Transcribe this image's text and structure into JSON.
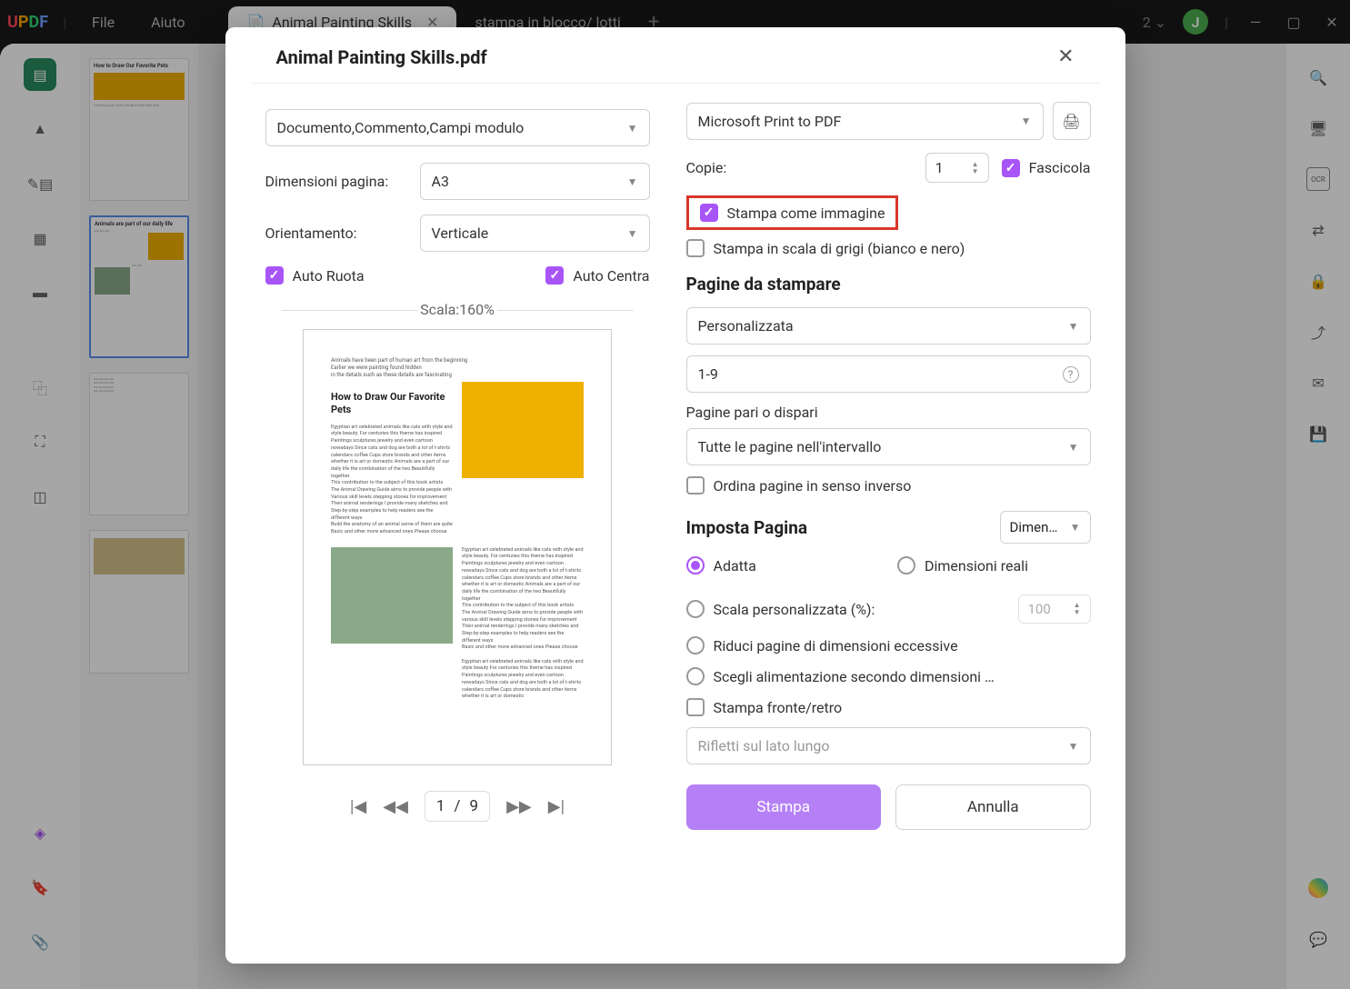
{
  "titlebar": {
    "logo": "UPDF",
    "menu_file": "File",
    "menu_help": "Aiuto",
    "tab1": "Animal Painting Skills",
    "tab2": "stampa in blocco/ lotti",
    "counter": "2",
    "avatar": "J"
  },
  "dialog": {
    "title": "Animal Painting Skills.pdf",
    "content_select": "Documento,Commento,Campi modulo",
    "page_size_label": "Dimensioni pagina:",
    "page_size_value": "A3",
    "orientation_label": "Orientamento:",
    "orientation_value": "Verticale",
    "auto_rotate": "Auto Ruota",
    "auto_center": "Auto Centra",
    "scale_label": "Scala:160%",
    "preview": {
      "heading": "How to Draw Our Favorite Pets"
    },
    "pager": {
      "current": "1",
      "sep": "/",
      "total": "9"
    },
    "printer": "Microsoft Print to PDF",
    "copies_label": "Copie:",
    "copies_value": "1",
    "collate": "Fascicola",
    "print_as_image": "Stampa come immagine",
    "grayscale": "Stampa in scala di grigi (bianco e nero)",
    "pages_section": "Pagine da stampare",
    "range_mode": "Personalizzata",
    "range_value": "1-9",
    "odd_even_label": "Pagine pari o dispari",
    "odd_even_value": "Tutte le pagine nell'intervallo",
    "reverse": "Ordina pagine in senso inverso",
    "page_setup_section": "Imposta Pagina",
    "page_setup_select": "Dimen…",
    "radio_fit": "Adatta",
    "radio_actual": "Dimensioni reali",
    "radio_custom": "Scala personalizzata (%):",
    "custom_scale_value": "100",
    "radio_shrink": "Riduci pagine di dimensioni eccessive",
    "radio_source": "Scegli alimentazione secondo dimensioni …",
    "duplex": "Stampa fronte/retro",
    "flip": "Rifletti sul lato lungo",
    "btn_print": "Stampa",
    "btn_cancel": "Annulla"
  },
  "thumbs": {
    "title1": "How to Draw Our Favorite Pets",
    "title2": "Animals are part of our daily life"
  }
}
